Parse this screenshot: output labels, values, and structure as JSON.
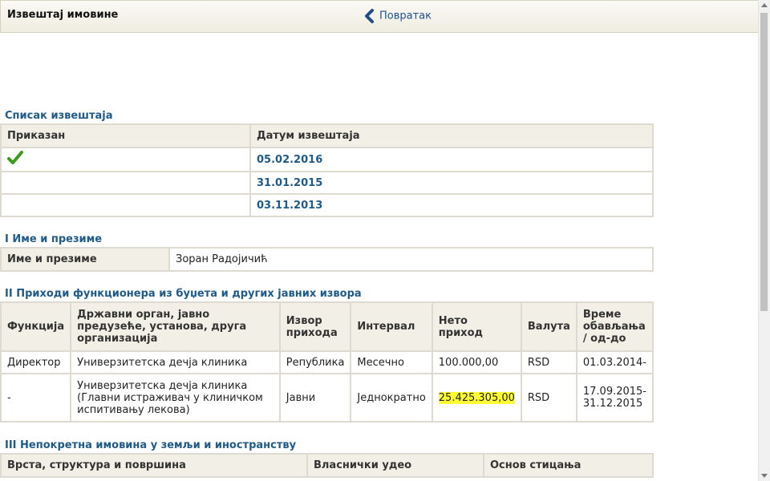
{
  "header": {
    "title": "Извештај имовине",
    "back_label": "Повратак"
  },
  "reports": {
    "title": "Списак извештаја",
    "columns": [
      "Приказан",
      "Датум извештаја"
    ],
    "rows": [
      {
        "shown": true,
        "date": "05.02.2016"
      },
      {
        "shown": false,
        "date": "31.01.2015"
      },
      {
        "shown": false,
        "date": "03.11.2013"
      }
    ]
  },
  "name_section": {
    "title": "I Име и презиме",
    "label": "Име и презиме",
    "value": "Зоран Радојичић"
  },
  "income": {
    "title": "II Приходи функционера из буџета и других јавних извора",
    "columns": [
      "Функција",
      "Државни орган, јавно предузеће, установа, друга организација",
      "Извор прихода",
      "Интервал",
      "Нето приход",
      "Валута",
      "Време обављања / од-до"
    ],
    "rows": [
      {
        "function": "Директор",
        "org": "Универзитетска дечја клиника",
        "source": "Република",
        "interval": "Месечно",
        "net": "100.000,00",
        "currency": "RSD",
        "period": "01.03.2014-"
      },
      {
        "function": "-",
        "org": "Универзитетска дечја клиника (Главни истраживач у клиничком испитивању лекова)",
        "source": "Јавни",
        "interval": "Једнократно",
        "net": "25.425.305,00",
        "currency": "RSD",
        "period": "17.09.2015-31.12.2015"
      }
    ]
  },
  "real_estate": {
    "title": "III Непокретна имовина у земљи и иностранству",
    "columns": [
      "Врста, структура и површина",
      "Власнички удео",
      "Основ стицања"
    ]
  },
  "colors": {
    "link": "#1e5a8a",
    "header_bg": "#f2f0e6",
    "border": "#dedad0",
    "highlight": "#ffff33",
    "check": "#3a9b1a"
  }
}
